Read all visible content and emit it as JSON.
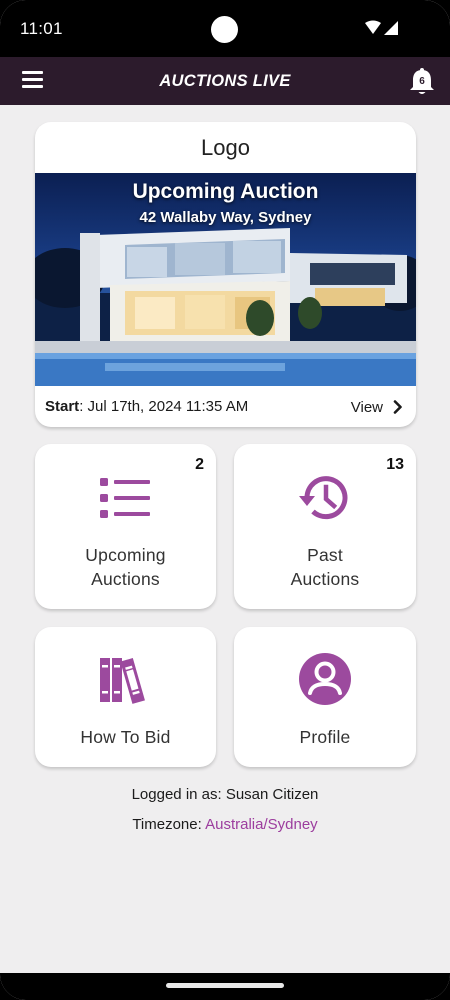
{
  "status_bar": {
    "time": "11:01",
    "icons": [
      "wifi-icon",
      "signal-icon"
    ]
  },
  "app_bar": {
    "title": "AUCTIONS LIVE",
    "menu_icon": "hamburger-menu-icon",
    "notification_icon": "bell-icon",
    "notification_count": "6",
    "bar_color": "#2c1b2c"
  },
  "featured": {
    "logo_text": "Logo",
    "image_title": "Upcoming Auction",
    "image_subtitle": "42 Wallaby Way, Sydney",
    "start_label": "Start",
    "start_value": ": Jul 17th, 2024 11:35 AM",
    "view_label": "View"
  },
  "tiles": [
    {
      "line1": "Upcoming",
      "line2": "Auctions",
      "count": "2",
      "icon": "list-icon"
    },
    {
      "line1": "Past",
      "line2": "Auctions",
      "count": "13",
      "icon": "history-icon"
    },
    {
      "label": "How To Bid",
      "icon": "books-icon"
    },
    {
      "label": "Profile",
      "icon": "account-circle-icon"
    }
  ],
  "footer": {
    "logged_in_text": "Logged in as: Susan Citizen",
    "timezone_label": "Timezone: ",
    "timezone_value": "Australia/Sydney"
  },
  "colors": {
    "accent": "#9c4a9e",
    "link": "#9c3d9e",
    "background": "#efeeef"
  }
}
